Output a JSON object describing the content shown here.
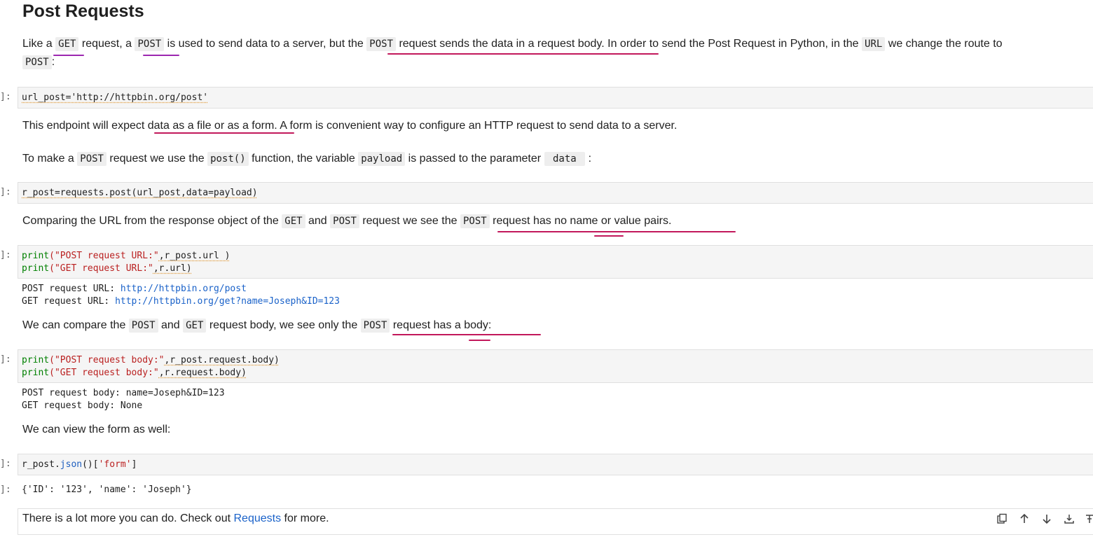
{
  "heading": "Post Requests",
  "p1": {
    "t1": "Like a ",
    "c1": "GET",
    "t2": " request, a ",
    "c2": "POST",
    "t3": " is used to send data to a server, but the ",
    "c3": "POST",
    "t4": " request sends the data in a request body. In order to send the Post Request in Python, in the ",
    "c4": "URL",
    "t5": " we change the route to",
    "c5": "POST",
    "t6": ":"
  },
  "cell1": {
    "prompt": "]:",
    "code": "url_post='http://httpbin.org/post'"
  },
  "p2": "This endpoint will expect data as a file or as a form. A form is convenient way to configure an HTTP request to send data to a server.",
  "p3": {
    "t1": "To make a ",
    "c1": "POST",
    "t2": " request we use the ",
    "c2": "post()",
    "t3": " function, the variable ",
    "c3": "payload",
    "t4": " is passed to the parameter ",
    "c4": " data ",
    "t5": " :"
  },
  "cell2": {
    "prompt": "]:",
    "code": "r_post=requests.post(url_post,data=payload)"
  },
  "p4": {
    "t1": "Comparing the URL from the response object of the ",
    "c1": "GET",
    "t2": " and ",
    "c2": "POST",
    "t3": " request we see the ",
    "c3": "POST",
    "t4": " request has no name or value pairs."
  },
  "cell3": {
    "prompt": "]:",
    "line1_kw": "print",
    "line1_str": "(\"POST request URL:\"",
    "line1_rest": ",r_post.url )",
    "line2_kw": "print",
    "line2_str": "(\"GET request URL:\"",
    "line2_rest": ",r.url)",
    "out1_label": "POST request URL: ",
    "out1_link": "http://httpbin.org/post",
    "out2_label": "GET request URL: ",
    "out2_link": "http://httpbin.org/get?name=Joseph&ID=123"
  },
  "p5": {
    "t1": "We can compare the ",
    "c1": "POST",
    "t2": " and ",
    "c2": "GET",
    "t3": " request body, we see only the ",
    "c3": "POST",
    "t4": " request has a body:"
  },
  "cell4": {
    "prompt": "]:",
    "line1_kw": "print",
    "line1_str": "(\"POST request body:\"",
    "line1_rest": ",r_post.request.body)",
    "line2_kw": "print",
    "line2_str": "(\"GET request body:\"",
    "line2_rest": ",r.request.body)",
    "out1": "POST request body: name=Joseph&ID=123",
    "out2": "GET request body: None"
  },
  "p6": "We can view the form as well:",
  "cell5": {
    "prompt": "]:",
    "code_a": "r_post.",
    "code_b": "json",
    "code_c": "()[",
    "code_d": "'form'",
    "code_e": "]"
  },
  "out5": {
    "prompt": "]:",
    "text": "{'ID': '123', 'name': 'Joseph'}"
  },
  "p7": {
    "t1": "There is a lot more you can do. Check out ",
    "link": "Requests",
    "t2": " for more."
  },
  "colors": {
    "accent_ink": "#c2185b",
    "purple_ink": "#9c27b0",
    "link": "#1a62c9"
  },
  "toolbar_icons": [
    "copy-icon",
    "arrow-up-icon",
    "arrow-down-icon",
    "insert-icon",
    "more-icon"
  ]
}
